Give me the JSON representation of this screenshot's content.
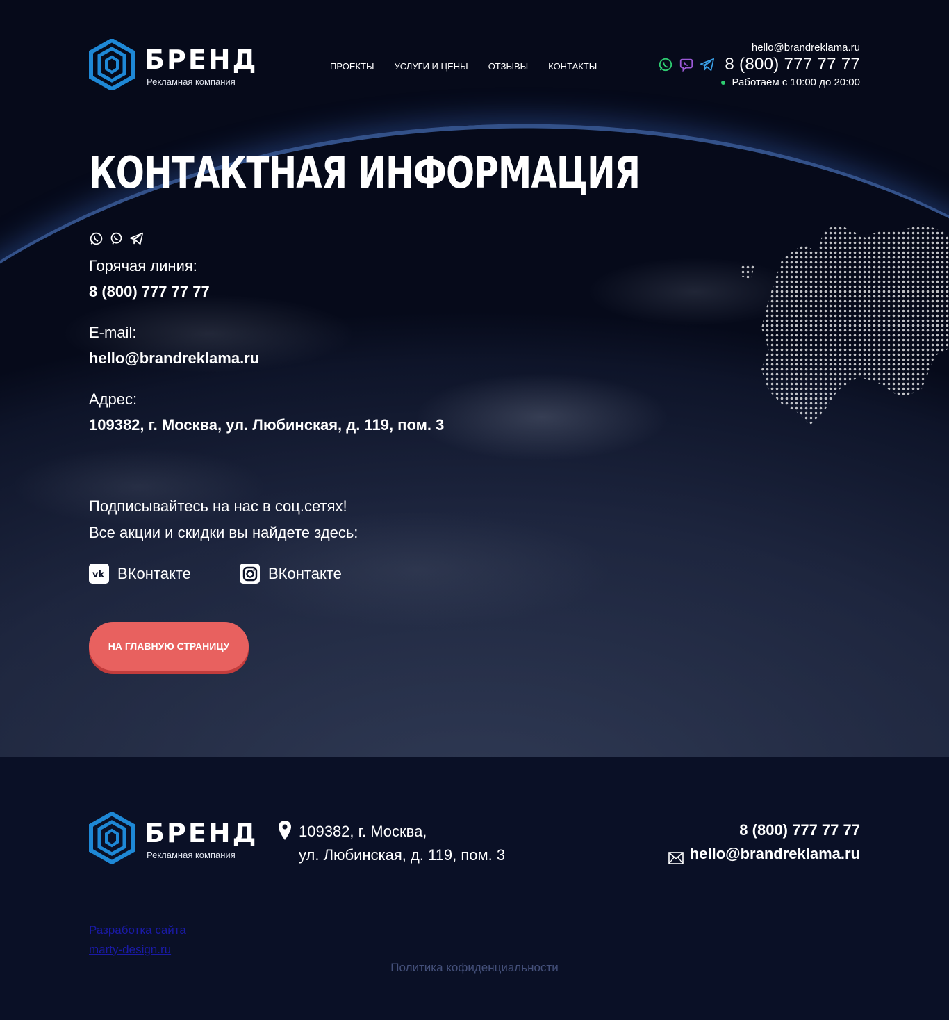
{
  "header": {
    "brand_name": "БРЕНД",
    "brand_tagline": "Рекламная компания",
    "nav": [
      "ПРОЕКТЫ",
      "УСЛУГИ И ЦЕНЫ",
      "ОТЗЫВЫ",
      "КОНТАКТЫ"
    ],
    "email": "hello@brandreklama.ru",
    "phone": "8 (800) 777 77 77",
    "hours": "Работаем с 10:00 до 20:00"
  },
  "contacts": {
    "title": "Контактная информация",
    "hotline_label": "Горячая линия:",
    "hotline_value": "8 (800) 777 77 77",
    "email_label": "E-mail:",
    "email_value": "hello@brandreklama.ru",
    "address_label": "Адрес:",
    "address_value": "109382, г. Москва, ул. Любинская, д. 119, пом. 3",
    "social_line1": "Подписывайтесь на нас в соц.сетях!",
    "social_line2": "Все акции и скидки вы найдете здесь:",
    "social_vk": "ВКонтакте",
    "social_instagram": "ВКонтакте",
    "cta": "НА ГЛАВНУЮ СТРАНИЦУ"
  },
  "footer": {
    "brand_name": "БРЕНД",
    "brand_tagline": "Рекламная компания",
    "address_line1": "109382, г. Москва,",
    "address_line2": "ул. Любинская, д. 119, пом. 3",
    "phone": "8 (800) 777 77 77",
    "email": "hello@brandreklama.ru",
    "dev_line1": "Разработка сайта",
    "dev_line2": "marty-design.ru",
    "policy": "Политика кофиденциальности"
  },
  "colors": {
    "background": "#0a1026",
    "accent_button": "#e8615f",
    "logo_blue": "#1e88d6",
    "whatsapp": "#2ecc71",
    "viber": "#9b59d6",
    "telegram": "#3aa0e8",
    "status_dot": "#2ecc71"
  },
  "icons": [
    "whatsapp-icon",
    "viber-icon",
    "telegram-icon",
    "vk-icon",
    "instagram-icon",
    "map-pin-icon",
    "mail-icon"
  ]
}
